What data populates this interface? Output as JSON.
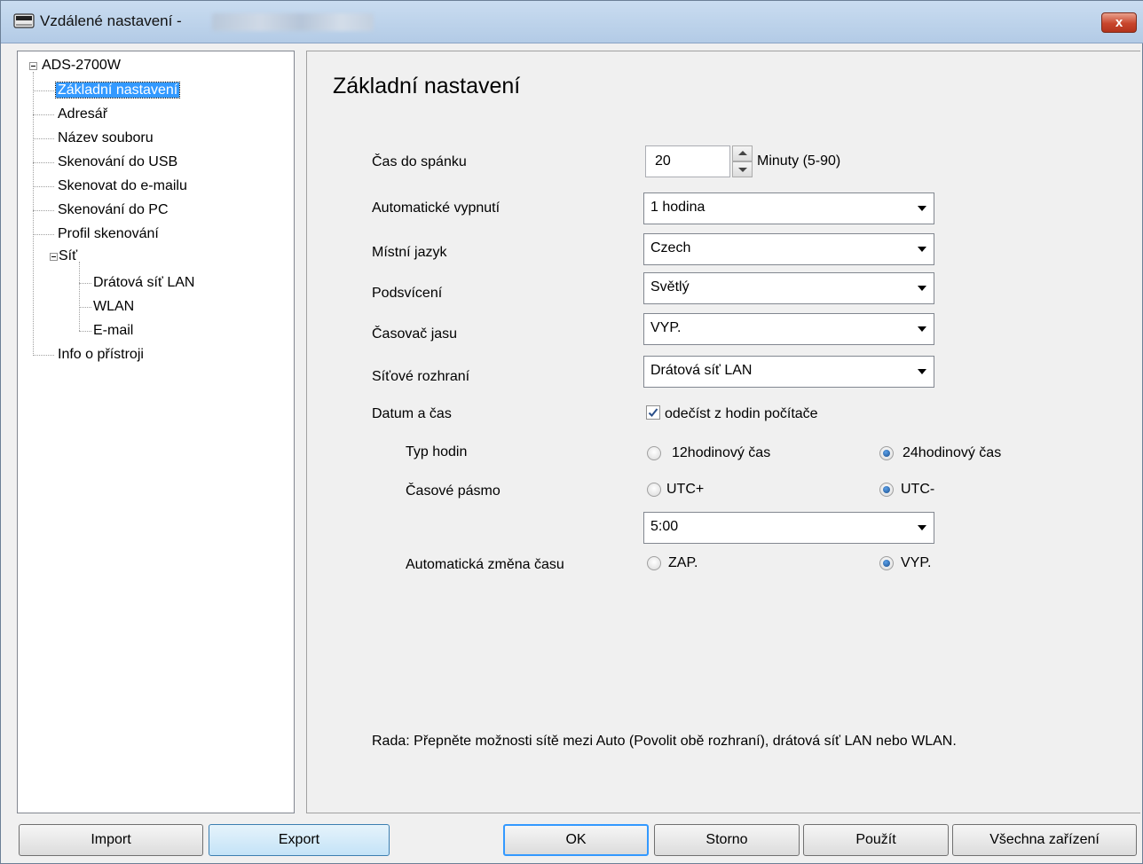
{
  "window": {
    "title": "Vzdálené nastavení -",
    "close_label": "x"
  },
  "tree": {
    "root": "ADS-2700W",
    "items": [
      "Základní nastavení",
      "Adresář",
      "Název souboru",
      "Skenování do USB",
      "Skenovat do e-mailu",
      "Skenování do PC",
      "Profil skenování"
    ],
    "network": "Síť",
    "network_items": [
      "Drátová síť LAN",
      "WLAN",
      "E-mail"
    ],
    "device_info": "Info o přístroji",
    "selected": "Základní nastavení"
  },
  "main": {
    "title": "Základní nastavení",
    "sleep": {
      "label": "Čas do spánku",
      "value": "20",
      "units": "Minuty (5-90)"
    },
    "auto_off": {
      "label": "Automatické vypnutí",
      "value": "1 hodina"
    },
    "language": {
      "label": "Místní jazyk",
      "value": "Czech"
    },
    "backlight": {
      "label": "Podsvícení",
      "value": "Světlý"
    },
    "dim_timer": {
      "label": "Časovač jasu",
      "value": "VYP."
    },
    "network_interface": {
      "label": "Síťové rozhraní",
      "value": "Drátová síť LAN"
    },
    "datetime": {
      "label": "Datum a čas",
      "checkbox_label": "odečíst z hodin počítače",
      "checked": true
    },
    "clock_type": {
      "label": "Typ hodin",
      "option1": "12hodinový čas",
      "option2": "24hodinový čas",
      "selected": "24hodinový čas"
    },
    "timezone": {
      "label": "Časové pásmo",
      "option1": "UTC+",
      "option2": "UTC-",
      "selected": "UTC-",
      "value": "5:00"
    },
    "dst": {
      "label": "Automatická změna času",
      "option1": "ZAP.",
      "option2": "VYP.",
      "selected": "VYP."
    },
    "hint": "Rada: Přepněte možnosti sítě mezi Auto (Povolit obě rozhraní), drátová síť LAN nebo WLAN."
  },
  "buttons": {
    "import": "Import",
    "export": "Export",
    "ok": "OK",
    "cancel": "Storno",
    "apply": "Použít",
    "all_devices": "Všechna zařízení"
  }
}
